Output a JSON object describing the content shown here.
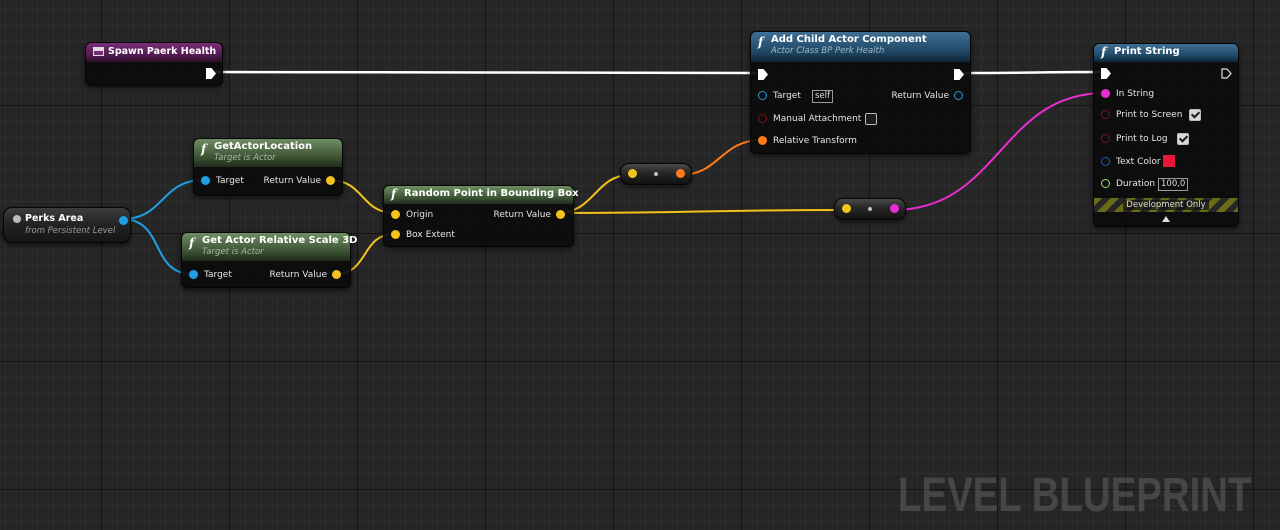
{
  "watermark": "LEVEL BLUEPRINT",
  "nodes": {
    "spawn_event": {
      "title": "Spawn Paerk Health",
      "icon": "custom-event-icon"
    },
    "perks_area": {
      "title": "Perks Area",
      "subtitle": "from Persistent Level",
      "icon": "actor-reference-icon"
    },
    "get_actor_location": {
      "icon": "function-icon",
      "fn_glyph": "f",
      "title": "GetActorLocation",
      "subtitle": "Target is Actor",
      "pins": {
        "target": "Target",
        "return_value": "Return Value"
      }
    },
    "get_actor_relative_scale": {
      "icon": "function-icon",
      "fn_glyph": "f",
      "title": "Get Actor Relative Scale 3D",
      "subtitle": "Target is Actor",
      "pins": {
        "target": "Target",
        "return_value": "Return Value"
      }
    },
    "random_point": {
      "icon": "function-icon",
      "fn_glyph": "f",
      "title": "Random Point in Bounding Box",
      "pins": {
        "origin": "Origin",
        "box_extent": "Box Extent",
        "return_value": "Return Value"
      }
    },
    "add_child_actor": {
      "icon": "function-icon",
      "fn_glyph": "f",
      "title": "Add Child Actor Component",
      "subtitle": "Actor Class BP Perk Health",
      "pins": {
        "target": "Target",
        "target_value": "self",
        "return_value": "Return Value",
        "manual_attachment": "Manual Attachment",
        "manual_attachment_checked": false,
        "relative_transform": "Relative Transform"
      }
    },
    "print_string": {
      "icon": "function-icon",
      "fn_glyph": "f",
      "title": "Print String",
      "pins": {
        "in_string": "In String",
        "print_to_screen": "Print to Screen",
        "print_to_screen_checked": true,
        "print_to_log": "Print to Log",
        "print_to_log_checked": true,
        "text_color": "Text Color",
        "text_color_value": "#e8173a",
        "duration": "Duration",
        "duration_value": "100,0"
      },
      "footer": "Development Only"
    }
  },
  "colors": {
    "exec": "#ffffff",
    "vector": "#f2c41d",
    "object": "#1fa0e6",
    "transform": "#ff7a1a",
    "string": "#ea2dd1",
    "bool": "#7a1515",
    "float": "#99e06c",
    "linear_color": "#1c5ec0"
  }
}
